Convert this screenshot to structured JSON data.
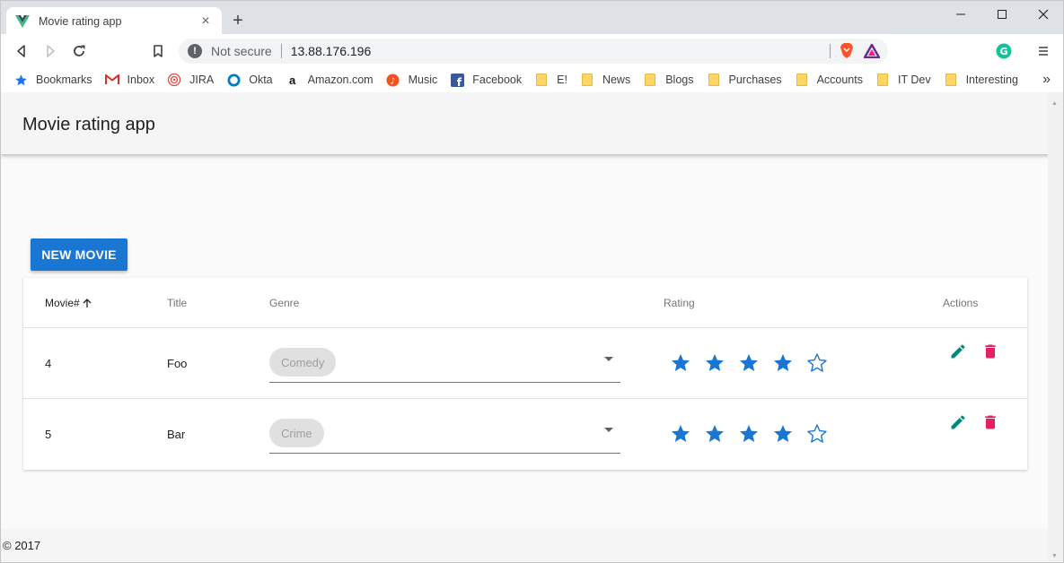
{
  "browser": {
    "tab_title": "Movie rating app",
    "new_tab_symbol": "+",
    "security_label": "Not secure",
    "url": "13.88.176.196",
    "icons": [
      "vue-favicon",
      "back-icon",
      "forward-icon",
      "reload-icon",
      "bookmark-icon",
      "info-icon",
      "brave-shields-icon",
      "brave-rewards-icon",
      "grammarly-icon",
      "menu-icon"
    ]
  },
  "bookmarks": [
    {
      "label": "Bookmarks",
      "icon": "star-icon"
    },
    {
      "label": "Inbox",
      "icon": "gmail-icon"
    },
    {
      "label": "JIRA",
      "icon": "jira-icon"
    },
    {
      "label": "Okta",
      "icon": "okta-icon"
    },
    {
      "label": "Amazon.com",
      "icon": "amazon-icon"
    },
    {
      "label": "Music",
      "icon": "music-icon"
    },
    {
      "label": "Facebook",
      "icon": "facebook-icon"
    },
    {
      "label": "E!",
      "icon": "folder-icon"
    },
    {
      "label": "News",
      "icon": "folder-icon"
    },
    {
      "label": "Blogs",
      "icon": "folder-icon"
    },
    {
      "label": "Purchases",
      "icon": "folder-icon"
    },
    {
      "label": "Accounts",
      "icon": "folder-icon"
    },
    {
      "label": "IT Dev",
      "icon": "folder-icon"
    },
    {
      "label": "Interesting",
      "icon": "folder-icon"
    }
  ],
  "app": {
    "title": "Movie rating app",
    "new_button": "NEW MOVIE",
    "footer": "© 2017"
  },
  "table": {
    "headers": {
      "id": "Movie#",
      "title": "Title",
      "genre": "Genre",
      "rating": "Rating",
      "actions": "Actions"
    },
    "sort_icon": "arrow-up-icon",
    "rows": [
      {
        "id": "4",
        "title": "Foo",
        "genre": "Comedy",
        "rating": 4,
        "max_rating": 5
      },
      {
        "id": "5",
        "title": "Bar",
        "genre": "Crime",
        "rating": 4,
        "max_rating": 5
      }
    ]
  },
  "colors": {
    "primary": "#1976d2",
    "star": "#1976d2",
    "edit": "#00897b",
    "delete": "#e91e63"
  }
}
